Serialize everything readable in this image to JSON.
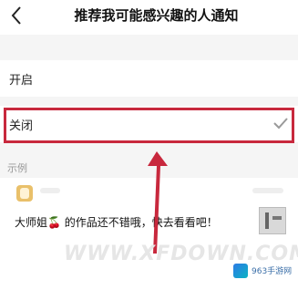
{
  "header": {
    "title": "推荐我可能感兴趣的人通知",
    "back_icon": "chevron-left-icon"
  },
  "options": [
    {
      "label": "开启",
      "selected": false
    },
    {
      "label": "关闭",
      "selected": true
    }
  ],
  "check_icon": "checkmark-icon",
  "example": {
    "section_label": "示例",
    "message": "大师姐🍒 的作品还不错哦，快去看看吧！"
  },
  "watermark": "WWW.XFDOWN.COM",
  "site_logo_text": "963手游网",
  "colors": {
    "highlight": "#c8283d",
    "accent": "#e6e6e6"
  }
}
